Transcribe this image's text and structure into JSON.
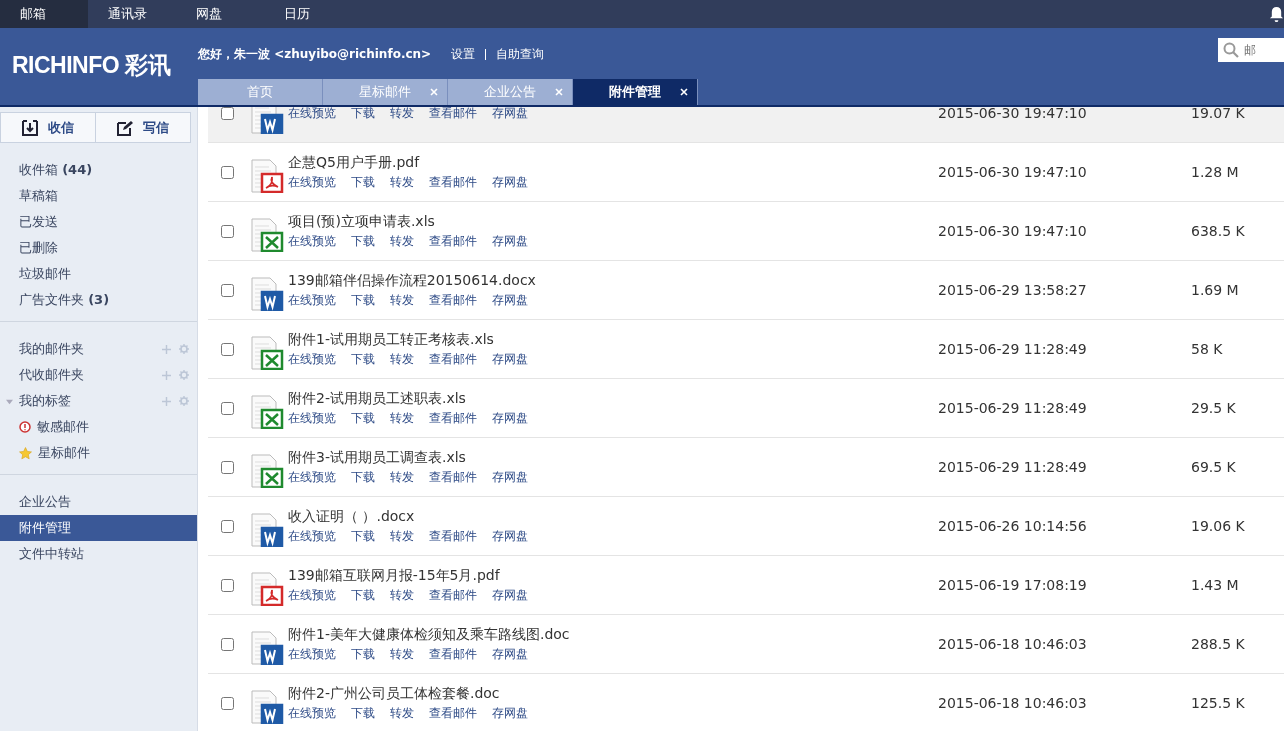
{
  "top_nav": [
    {
      "label": "邮箱",
      "selected": true
    },
    {
      "label": "通讯录",
      "selected": false
    },
    {
      "label": "网盘",
      "selected": false
    },
    {
      "label": "日历",
      "selected": false
    }
  ],
  "header": {
    "logo": "RICHINFO 彩讯",
    "greeting": "您好，朱一波 <zhuyibo@richinfo.cn>",
    "links": [
      "设置",
      "自助查询"
    ],
    "search": {
      "placeholder": "邮"
    }
  },
  "tabs": [
    {
      "label": "首页",
      "selected": false,
      "closable": false
    },
    {
      "label": "星标邮件",
      "selected": false,
      "closable": true
    },
    {
      "label": "企业公告",
      "selected": false,
      "closable": true
    },
    {
      "label": "附件管理",
      "selected": true,
      "closable": true
    }
  ],
  "sidebar": {
    "buttons": [
      {
        "label": "收信",
        "kind": "receive"
      },
      {
        "label": "写信",
        "kind": "compose"
      }
    ],
    "groups": [
      {
        "items": [
          {
            "label": "收件箱",
            "count": "(44)",
            "selected": false
          },
          {
            "label": "草稿箱",
            "selected": false
          },
          {
            "label": "已发送",
            "selected": false
          },
          {
            "label": "已删除",
            "selected": false
          },
          {
            "label": "垃圾邮件",
            "selected": false
          },
          {
            "label": "广告文件夹",
            "count": "(3)",
            "selected": false
          }
        ]
      },
      {
        "items": [
          {
            "label": "我的邮件夹",
            "selected": false,
            "tools": true
          },
          {
            "label": "代收邮件夹",
            "selected": false,
            "tools": true
          },
          {
            "label": "我的标签",
            "selected": false,
            "tools": true,
            "expanded": true,
            "children": [
              {
                "label": "敏感邮件",
                "kind": "alert",
                "selected": false
              },
              {
                "label": "星标邮件",
                "kind": "star",
                "selected": false
              }
            ]
          }
        ]
      },
      {
        "items": [
          {
            "label": "企业公告",
            "selected": false
          },
          {
            "label": "附件管理",
            "selected": true
          },
          {
            "label": "文件中转站",
            "selected": false
          }
        ]
      }
    ]
  },
  "files": [
    {
      "kind": "word",
      "date": "2015-06-30 19:47:10",
      "size": "19.07 K",
      "hovered": true,
      "actions": [
        "在线预览",
        "下载",
        "转发",
        "查看邮件",
        "存网盘"
      ]
    },
    {
      "kind": "pdf",
      "name": "企慧Q5用户手册.pdf",
      "date": "2015-06-30 19:47:10",
      "size": "1.28 M",
      "hovered": false,
      "actions": [
        "在线预览",
        "下载",
        "转发",
        "查看邮件",
        "存网盘"
      ]
    },
    {
      "kind": "excel",
      "name": "项目(预)立项申请表.xls",
      "date": "2015-06-30 19:47:10",
      "size": "638.5 K",
      "hovered": false,
      "actions": [
        "在线预览",
        "下载",
        "转发",
        "查看邮件",
        "存网盘"
      ]
    },
    {
      "kind": "word",
      "name": "139邮箱伴侣操作流程20150614.docx",
      "date": "2015-06-29 13:58:27",
      "size": "1.69 M",
      "hovered": false,
      "actions": [
        "在线预览",
        "下载",
        "转发",
        "查看邮件",
        "存网盘"
      ]
    },
    {
      "kind": "excel",
      "name": "附件1-试用期员工转正考核表.xls",
      "date": "2015-06-29 11:28:49",
      "size": "58 K",
      "hovered": false,
      "actions": [
        "在线预览",
        "下载",
        "转发",
        "查看邮件",
        "存网盘"
      ]
    },
    {
      "kind": "excel",
      "name": "附件2-试用期员工述职表.xls",
      "date": "2015-06-29 11:28:49",
      "size": "29.5 K",
      "hovered": false,
      "actions": [
        "在线预览",
        "下载",
        "转发",
        "查看邮件",
        "存网盘"
      ]
    },
    {
      "kind": "excel",
      "name": "附件3-试用期员工调查表.xls",
      "date": "2015-06-29 11:28:49",
      "size": "69.5 K",
      "hovered": false,
      "actions": [
        "在线预览",
        "下载",
        "转发",
        "查看邮件",
        "存网盘"
      ]
    },
    {
      "kind": "word",
      "name": "收入证明（ ）.docx",
      "date": "2015-06-26 10:14:56",
      "size": "19.06 K",
      "hovered": false,
      "actions": [
        "在线预览",
        "下载",
        "转发",
        "查看邮件",
        "存网盘"
      ]
    },
    {
      "kind": "pdf",
      "name": "139邮箱互联网月报-15年5月.pdf",
      "date": "2015-06-19 17:08:19",
      "size": "1.43 M",
      "hovered": false,
      "actions": [
        "在线预览",
        "下载",
        "转发",
        "查看邮件",
        "存网盘"
      ]
    },
    {
      "kind": "word",
      "name": "附件1-美年大健康体检须知及乘车路线图.doc",
      "date": "2015-06-18 10:46:03",
      "size": "288.5 K",
      "hovered": false,
      "actions": [
        "在线预览",
        "下载",
        "转发",
        "查看邮件",
        "存网盘"
      ]
    },
    {
      "kind": "word",
      "name": "附件2-广州公司员工体检套餐.doc",
      "date": "2015-06-18 10:46:03",
      "size": "125.5 K",
      "hovered": false,
      "actions": [
        "在线预览",
        "下载",
        "转发",
        "查看邮件",
        "存网盘"
      ]
    }
  ]
}
